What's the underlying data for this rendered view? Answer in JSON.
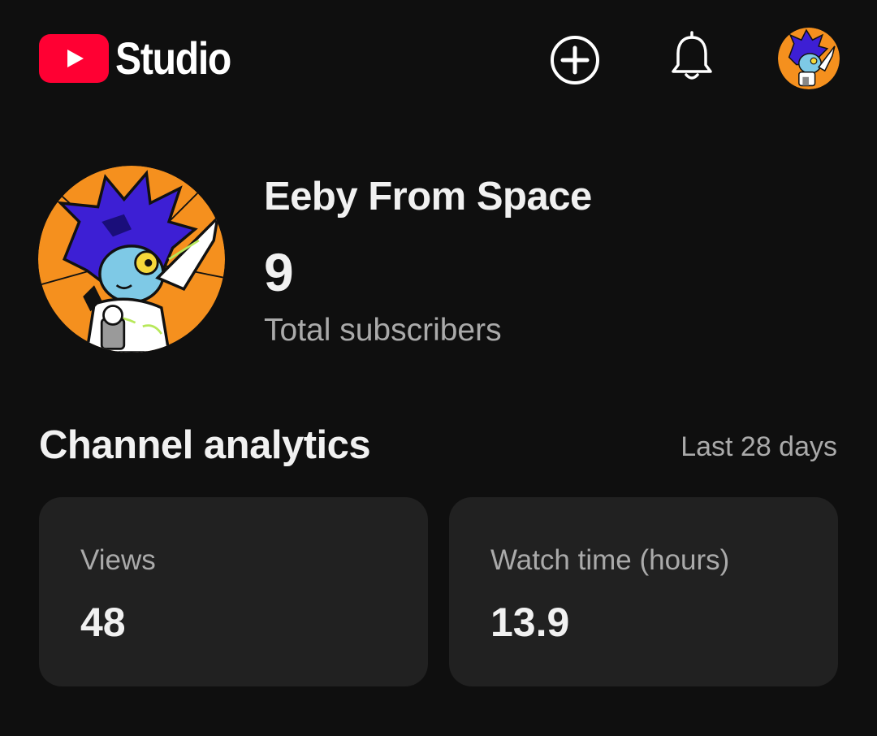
{
  "app": {
    "logo_text": "Studio",
    "brand_color": "#ff0033"
  },
  "topbar": {
    "create_icon": "add-circle-icon",
    "notifications_icon": "bell-icon",
    "account_icon": "account-avatar"
  },
  "channel": {
    "name": "Eeby From Space",
    "subscribers": "9",
    "subscribers_label": "Total subscribers"
  },
  "analytics": {
    "title": "Channel analytics",
    "period": "Last 28 days",
    "cards": [
      {
        "label": "Views",
        "value": "48"
      },
      {
        "label": "Watch time (hours)",
        "value": "13.9"
      }
    ]
  },
  "colors": {
    "background": "#0f0f0f",
    "card": "#212121",
    "secondary_text": "#aaaaaa",
    "avatar_orange": "#f5901e",
    "avatar_blue": "#3d1fd4"
  }
}
